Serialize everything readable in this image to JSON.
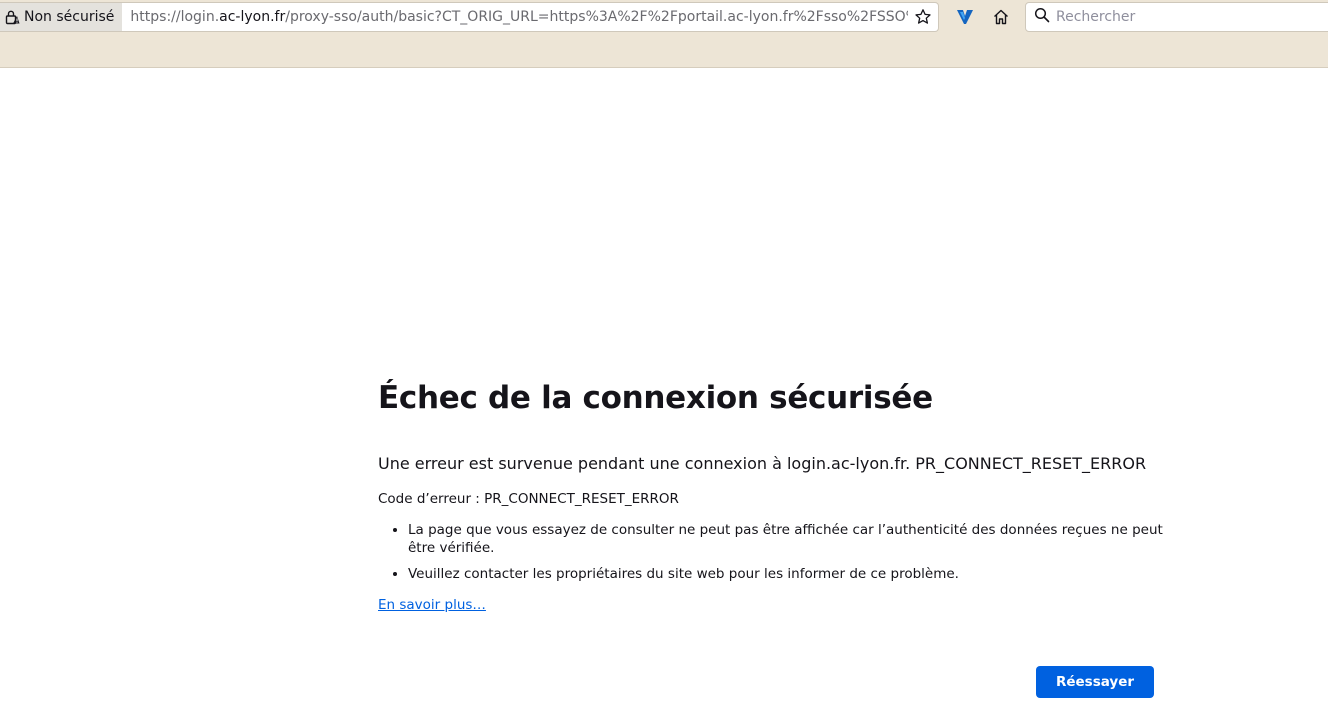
{
  "browser": {
    "identity_label": "Non sécurisé",
    "url_prefix": "https://login.",
    "url_host": "ac-lyon.fr",
    "url_rest": "/proxy-sso/auth/basic?CT_ORIG_URL=https%3A%2F%2Fportail.ac-lyon.fr%2Fsso%2FSSO%",
    "search_placeholder": "Rechercher"
  },
  "error_page": {
    "title": "Échec de la connexion sécurisée",
    "intro": "Une erreur est survenue pendant une connexion à login.ac-lyon.fr. PR_CONNECT_RESET_ERROR",
    "error_code": "Code d’erreur : PR_CONNECT_RESET_ERROR",
    "bullets": [
      "La page que vous essayez de consulter ne peut pas être affichée car l’authenticité des données reçues ne peut être vérifiée.",
      "Veuillez contacter les propriétaires du site web pour les informer de ce problème."
    ],
    "learn_more": "En savoir plus…",
    "retry_button": "Réessayer"
  },
  "colors": {
    "toolbar": "#ede5d6",
    "link": "#0061e0",
    "button": "#0061e0"
  }
}
